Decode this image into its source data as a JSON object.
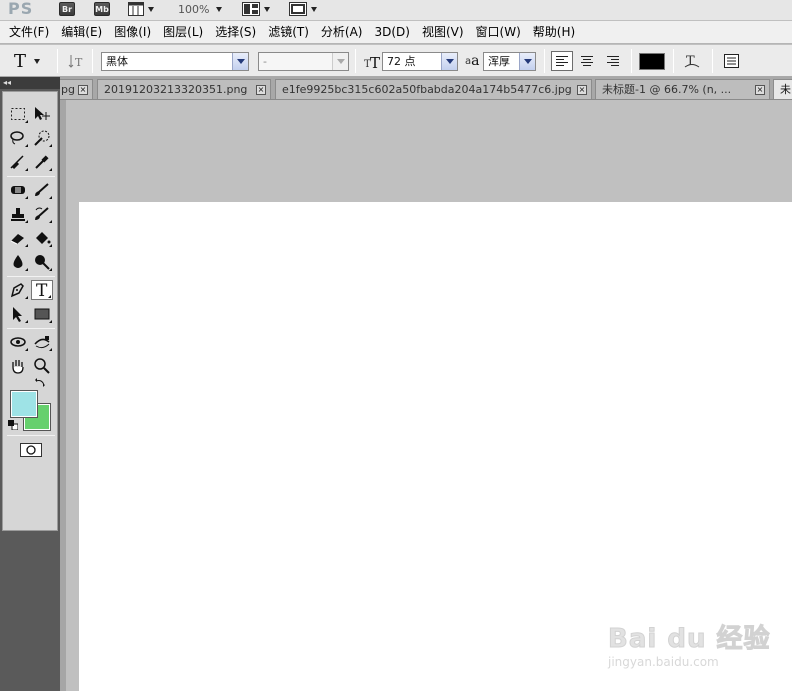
{
  "appbar": {
    "logo": "PS",
    "bridge": "Br",
    "minibridge": "Mb",
    "zoom": "100%"
  },
  "menu": {
    "items": [
      "文件(F)",
      "编辑(E)",
      "图像(I)",
      "图层(L)",
      "选择(S)",
      "滤镜(T)",
      "分析(A)",
      "3D(D)",
      "视图(V)",
      "窗口(W)",
      "帮助(H)"
    ]
  },
  "options": {
    "tool_glyph": "T",
    "font_family": "黑体",
    "font_style": "-",
    "font_size": "72 点",
    "aa_label": "a",
    "aa_small": "a",
    "antialias": "浑厚",
    "text_color": "#000000"
  },
  "tabs": [
    {
      "label": "pg",
      "active": false
    },
    {
      "label": "20191203213320351.png",
      "active": false
    },
    {
      "label": "e1fe9925bc315c602a50fbabda204a174b5477c6.jpg",
      "active": false
    },
    {
      "label": "未标题-1 @ 66.7% (n, ...",
      "active": false
    },
    {
      "label": "未",
      "active": true
    }
  ],
  "tab_close": "×",
  "toolbox": {
    "collapse": "◂◂",
    "foreground_color": "#9ee3e6",
    "background_color": "#66d06d"
  },
  "watermark": {
    "brand": "Bai du 经验",
    "url": "jingyan.baidu.com"
  }
}
